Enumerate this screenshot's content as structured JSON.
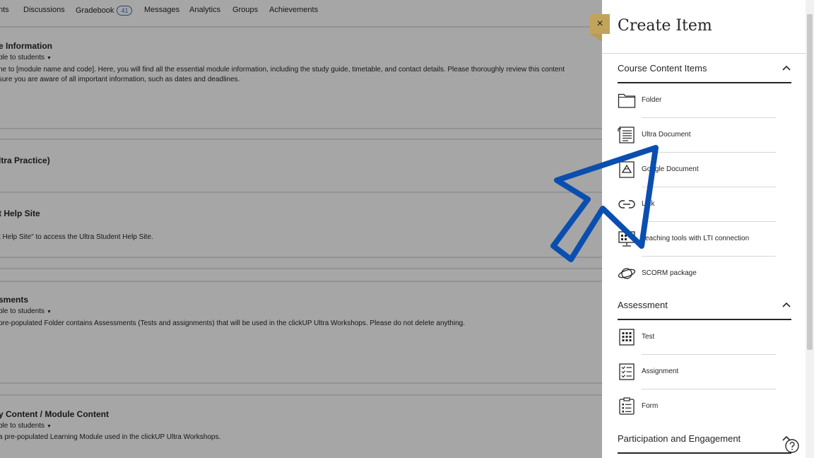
{
  "nav": {
    "items": [
      {
        "label": "nts"
      },
      {
        "label": "Discussions"
      },
      {
        "label": "Gradebook",
        "badge": "41"
      },
      {
        "label": "Messages"
      },
      {
        "label": "Analytics"
      },
      {
        "label": "Groups"
      },
      {
        "label": "Achievements"
      }
    ]
  },
  "sections": [
    {
      "title": "e Information",
      "visibility": "ble to students",
      "desc": [
        "ne to [module name and code]. Here, you will find all the essential module information, including the study guide, timetable, and contact details. Please thoroughly review this content",
        "sure you are aware of all important information, such as dates and deadlines."
      ]
    },
    {
      "title": "ltra Practice)"
    },
    {
      "title": "t Help Site",
      "desc": [
        "t Help Site\" to access the Ultra Student Help Site."
      ]
    },
    {
      "title": "sments",
      "visibility": "ble to students",
      "desc": [
        "pre-populated Folder contains Assessments (Tests and assignments) that will be used in the clickUP Ultra Workshops. Please do not delete anything."
      ]
    },
    {
      "title": "y Content / Module Content",
      "visibility": "ble to students",
      "desc": [
        "a pre-populated Learning Module used in the clickUP Ultra Workshops."
      ]
    }
  ],
  "panel": {
    "title": "Create Item",
    "close_icon": "×",
    "categories": [
      {
        "title": "Course Content Items",
        "items": [
          {
            "label": "Folder",
            "icon": "folder-icon"
          },
          {
            "label": "Ultra Document",
            "icon": "document-icon"
          },
          {
            "label": "Google Document",
            "icon": "google-drive-icon"
          },
          {
            "label": "Link",
            "icon": "link-icon"
          },
          {
            "label": "Teaching tools with LTI connection",
            "icon": "lti-tools-icon"
          },
          {
            "label": "SCORM package",
            "icon": "scorm-planet-icon"
          }
        ]
      },
      {
        "title": "Assessment",
        "items": [
          {
            "label": "Test",
            "icon": "test-grid-icon"
          },
          {
            "label": "Assignment",
            "icon": "assignment-checklist-icon"
          },
          {
            "label": "Form",
            "icon": "form-clipboard-icon"
          }
        ]
      },
      {
        "title": "Participation and Engagement",
        "items": []
      }
    ]
  },
  "colors": {
    "accent_gold": "#c1a35a",
    "pointer_blue": "#0a4fb0",
    "text": "#262626"
  }
}
